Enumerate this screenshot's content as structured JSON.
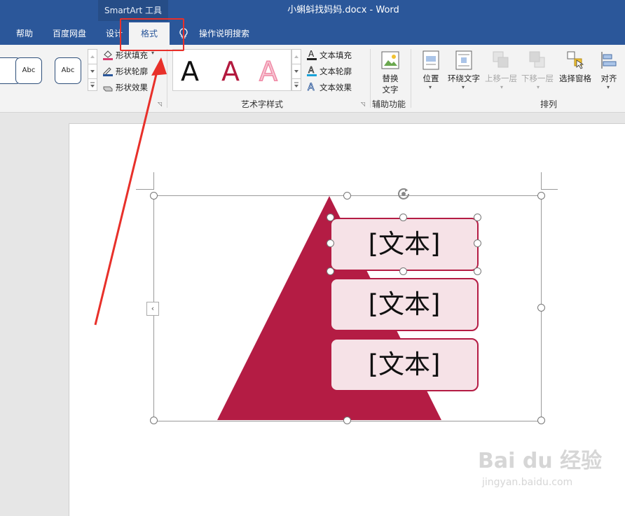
{
  "title_bar": {
    "context_tab": "SmartArt 工具",
    "document_title": "小蝌蚪找妈妈.docx  -  Word"
  },
  "tabs": {
    "help": "帮助",
    "baidu_netdisk": "百度网盘",
    "design": "设计",
    "format": "格式",
    "tell_me": "操作说明搜索"
  },
  "ribbon": {
    "shape_styles": {
      "sample_1": "Abc",
      "sample_2": "Abc",
      "shape_fill": "形状填充",
      "shape_outline": "形状轮廓",
      "shape_effects": "形状效果"
    },
    "wordart_styles": {
      "label": "艺术字样式",
      "text_fill": "文本填充",
      "text_outline": "文本轮廓",
      "text_effects": "文本效果",
      "letter": "A",
      "colors": {
        "black": "#111111",
        "red": "#b3193e",
        "pink": "#f08aa6"
      }
    },
    "accessibility": {
      "label": "辅助功能",
      "alt_text_line1": "替换",
      "alt_text_line2": "文字"
    },
    "arrange": {
      "label": "排列",
      "position": "位置",
      "wrap_text": "环绕文字",
      "bring_forward": "上移一层",
      "send_backward": "下移一层",
      "selection_pane": "选择窗格",
      "align": "对齐"
    }
  },
  "document": {
    "smartart_text_1": "[文本]",
    "smartart_text_2": "[文本]",
    "smartart_text_3": "[文本]",
    "pyramid_color": "#b41c44"
  },
  "watermark": {
    "brand": "Bai du 经验",
    "url": "jingyan.baidu.com"
  },
  "colors": {
    "ribbon_blue": "#2b579a",
    "highlight_red": "#e8302a"
  }
}
